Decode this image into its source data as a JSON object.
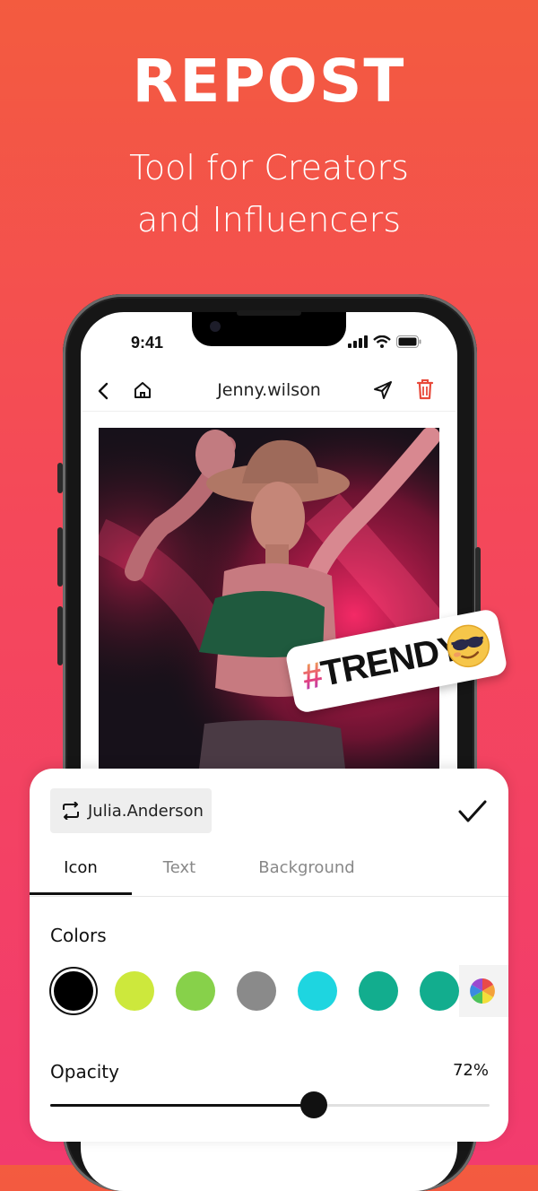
{
  "hero": {
    "title": "REPOST",
    "subtitle_line1": "Tool for Creators",
    "subtitle_line2": "and Influencers"
  },
  "status_bar": {
    "time": "9:41"
  },
  "header": {
    "username": "Jenny.wilson"
  },
  "sticker": {
    "hashtag": "#",
    "word": "TRENDY"
  },
  "panel": {
    "repost_user": "Julia.Anderson",
    "tabs": [
      {
        "label": "Icon",
        "active": true
      },
      {
        "label": "Text",
        "active": false
      },
      {
        "label": "Background",
        "active": false
      }
    ],
    "colors_label": "Colors",
    "colors": [
      "#000000",
      "#cde83c",
      "#87d14a",
      "#8a8a8a",
      "#1ed5e0",
      "#12ad8e",
      "#12ad8e"
    ],
    "selected_color": "#000000",
    "opacity_label": "Opacity",
    "opacity_value_text": "72%",
    "opacity": 0.6
  },
  "accent": {
    "delete": "#e8493a",
    "panel_bg": "#ffffff"
  }
}
